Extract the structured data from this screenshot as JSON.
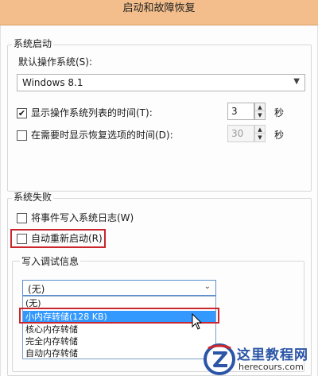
{
  "window": {
    "title": "启动和故障恢复"
  },
  "system_startup": {
    "legend": "系统启动",
    "default_os_label": "默认操作系统(S):",
    "default_os_value": "Windows 8.1",
    "show_list": {
      "label": "显示操作系统列表的时间(T):",
      "checked": true,
      "value": "3",
      "unit": "秒"
    },
    "show_recovery": {
      "label": "在需要时显示恢复选项的时间(D):",
      "checked": false,
      "value": "30",
      "unit": "秒"
    }
  },
  "system_failure": {
    "legend": "系统失败",
    "write_event_log": {
      "label": "将事件写入系统日志(W)",
      "checked": false
    },
    "auto_restart": {
      "label": "自动重新启动(R)",
      "checked": false
    },
    "debug_info": {
      "legend": "写入调试信息",
      "selected_value": "(无)",
      "options": [
        "(无)",
        "小内存转储(128 KB)",
        "核心内存转储",
        "完全内存转储",
        "自动内存转储"
      ]
    }
  },
  "watermark": {
    "name": "这里教程网",
    "url": "herecours.com"
  },
  "colors": {
    "titlebar": "#f3be8b",
    "highlight": "#c9262d",
    "selection": "#3399ff"
  }
}
